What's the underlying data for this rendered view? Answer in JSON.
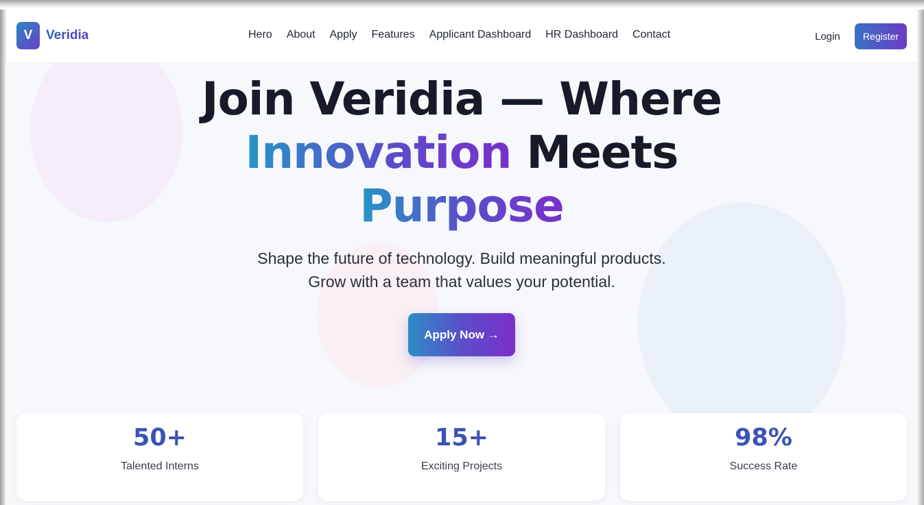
{
  "brand": {
    "logo_letter": "V",
    "name": "Veridia",
    "gradient": [
      "#2a86c4",
      "#6a3fc9"
    ]
  },
  "nav": {
    "links": [
      "Hero",
      "About",
      "Apply",
      "Features",
      "Applicant Dashboard",
      "HR Dashboard",
      "Contact"
    ],
    "login_label": "Login",
    "register_label": "Register"
  },
  "hero": {
    "title_line1": "Join Veridia — Where",
    "title_line2_highlight": "Innovation",
    "title_line2_rest": " Meets",
    "title_line3_highlight": "Purpose",
    "subtitle_line1": "Shape the future of technology. Build meaningful products.",
    "subtitle_line2": "Grow with a team that values your potential.",
    "cta_label": "Apply Now →"
  },
  "stats": [
    {
      "value": "50+",
      "label": "Talented Interns"
    },
    {
      "value": "15+",
      "label": "Exciting Projects"
    },
    {
      "value": "98%",
      "label": "Success Rate"
    }
  ],
  "colors": {
    "accent": "#3b53b3",
    "text": "#161b29",
    "background": "#f7f8fb"
  }
}
